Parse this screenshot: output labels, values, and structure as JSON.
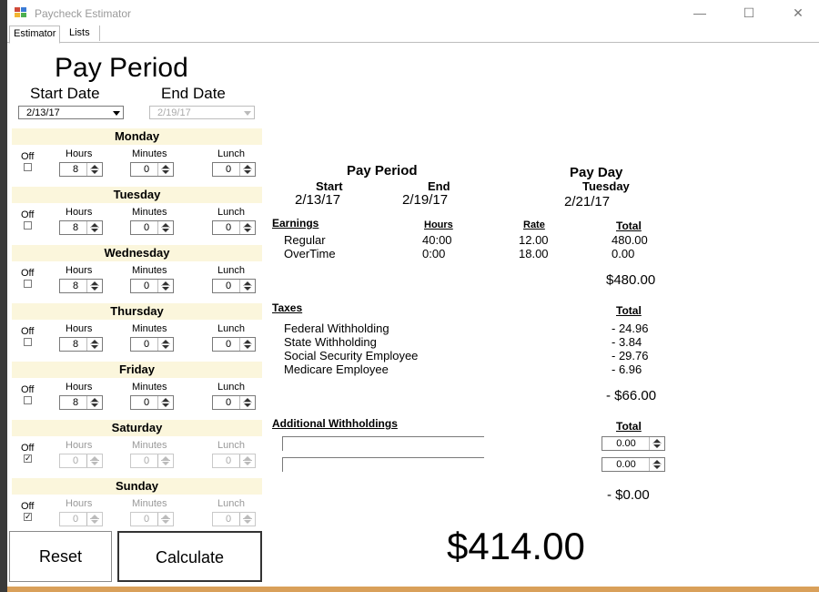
{
  "window": {
    "title": "Paycheck Estimator",
    "minimize": "—",
    "maximize": "☐",
    "close": "✕"
  },
  "tabs": [
    "Estimator",
    "Lists"
  ],
  "pay_period": {
    "title": "Pay Period",
    "start_label": "Start Date",
    "end_label": "End Date",
    "start_value": "2/13/17",
    "end_value": "2/19/17"
  },
  "col_labels": {
    "off": "Off",
    "hours": "Hours",
    "minutes": "Minutes",
    "lunch": "Lunch"
  },
  "days": [
    {
      "name": "Monday",
      "off": false,
      "hours": "8",
      "minutes": "0",
      "lunch": "0"
    },
    {
      "name": "Tuesday",
      "off": false,
      "hours": "8",
      "minutes": "0",
      "lunch": "0"
    },
    {
      "name": "Wednesday",
      "off": false,
      "hours": "8",
      "minutes": "0",
      "lunch": "0"
    },
    {
      "name": "Thursday",
      "off": false,
      "hours": "8",
      "minutes": "0",
      "lunch": "0"
    },
    {
      "name": "Friday",
      "off": false,
      "hours": "8",
      "minutes": "0",
      "lunch": "0"
    },
    {
      "name": "Saturday",
      "off": true,
      "hours": "0",
      "minutes": "0",
      "lunch": "0"
    },
    {
      "name": "Sunday",
      "off": true,
      "hours": "0",
      "minutes": "0",
      "lunch": "0"
    }
  ],
  "buttons": {
    "reset": "Reset",
    "calculate": "Calculate"
  },
  "summary": {
    "period_title": "Pay Period",
    "start_label": "Start",
    "end_label": "End",
    "start_value": "2/13/17",
    "end_value": "2/19/17",
    "payday_title": "Pay Day",
    "payday_weekday": "Tuesday",
    "payday_value": "2/21/17"
  },
  "earnings": {
    "title": "Earnings",
    "headers": {
      "hours": "Hours",
      "rate": "Rate",
      "total": "Total"
    },
    "rows": [
      {
        "label": "Regular",
        "hours": "40:00",
        "rate": "12.00",
        "total": "480.00"
      },
      {
        "label": "OverTime",
        "hours": "0:00",
        "rate": "18.00",
        "total": "0.00"
      }
    ],
    "sum": "$480.00"
  },
  "taxes": {
    "title": "Taxes",
    "total_header": "Total",
    "rows": [
      {
        "label": "Federal Withholding",
        "value": "- 24.96"
      },
      {
        "label": "State Withholding",
        "value": "- 3.84"
      },
      {
        "label": "Social Security Employee",
        "value": "- 29.76"
      },
      {
        "label": "Medicare Employee",
        "value": "- 6.96"
      }
    ],
    "sum": "- $66.00"
  },
  "additional": {
    "title": "Additional Withholdings",
    "total_header": "Total",
    "rows": [
      {
        "name": "",
        "value": "0.00"
      },
      {
        "name": "",
        "value": "0.00"
      }
    ],
    "sum": "- $0.00"
  },
  "net_pay": "$414.00"
}
